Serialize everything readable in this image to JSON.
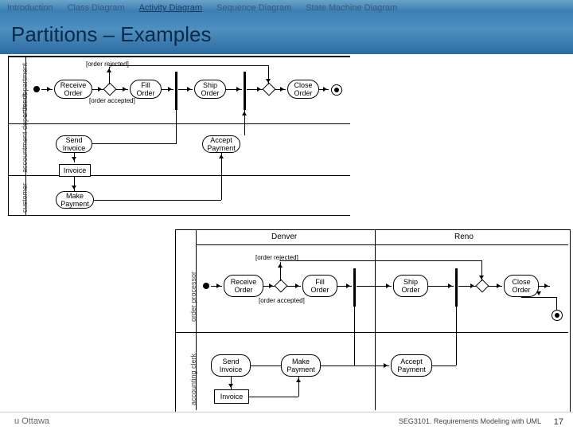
{
  "tabs": [
    "Introduction",
    "Class Diagram",
    "Activity Diagram",
    "Sequence Diagram",
    "State Machine Diagram"
  ],
  "activeTab": 2,
  "title": "Partitions – Examples",
  "upper": {
    "lanes": [
      "order department",
      "accountment department",
      "customer"
    ],
    "activities": [
      "Receive Order",
      "Fill Order",
      "Ship Order",
      "Close Order",
      "Send Invoice",
      "Accept Payment",
      "Make Payment"
    ],
    "object": "Invoice",
    "guards": [
      "[order rejected]",
      "[order accepted]"
    ]
  },
  "lower": {
    "columns": [
      "Denver",
      "Reno"
    ],
    "rows": [
      "order processor",
      "accounting clerk"
    ],
    "activities": [
      "Receive Order",
      "Fill Order",
      "Ship Order",
      "Close Order",
      "Send Invoice",
      "Make Payment",
      "Accept Payment"
    ],
    "object": "Invoice",
    "guards": [
      "[order rejected]",
      "[order accepted]"
    ]
  },
  "footer": {
    "logo": "u Ottawa",
    "course": "SEG3101. Requirements Modeling with UML",
    "page": "17"
  }
}
